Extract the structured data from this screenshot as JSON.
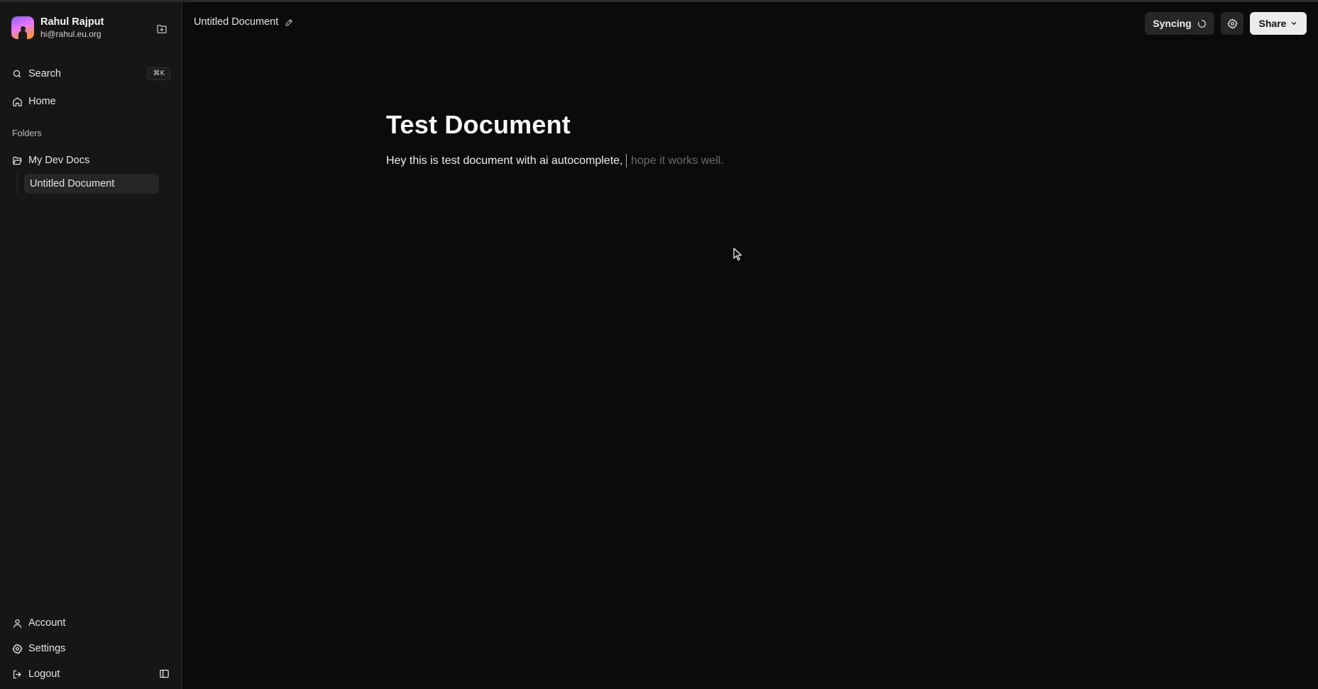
{
  "sidebar": {
    "user": {
      "name": "Rahul Rajput",
      "email": "hi@rahul.eu.org"
    },
    "search": {
      "label": "Search",
      "shortcut": "⌘K"
    },
    "home": {
      "label": "Home"
    },
    "folders_label": "Folders",
    "folder": {
      "label": "My Dev Docs"
    },
    "document": {
      "label": "Untitled Document"
    },
    "bottom": {
      "account": "Account",
      "settings": "Settings",
      "logout": "Logout"
    }
  },
  "header": {
    "doc_title": "Untitled Document",
    "sync_label": "Syncing",
    "share_label": "Share"
  },
  "editor": {
    "heading": "Test Document",
    "body_text": "Hey this is test document with ai autocomplete,",
    "ghost_suggestion": "hope it works well."
  },
  "icons": {
    "new_folder": "folder-plus-icon",
    "search": "search-icon",
    "home": "home-icon",
    "folder": "folder-open-icon",
    "account": "user-icon",
    "settings": "gear-icon",
    "logout": "logout-icon",
    "sidebar_toggle": "panel-left-icon",
    "edit": "pencil-icon",
    "sync": "spinner-icon",
    "chevron": "chevron-down-icon"
  },
  "colors": {
    "background": "#0a0a0a",
    "sidebar": "#161616",
    "active_item": "#262626",
    "ghost_text": "#6b6b6b",
    "share_button": "#ececec"
  }
}
